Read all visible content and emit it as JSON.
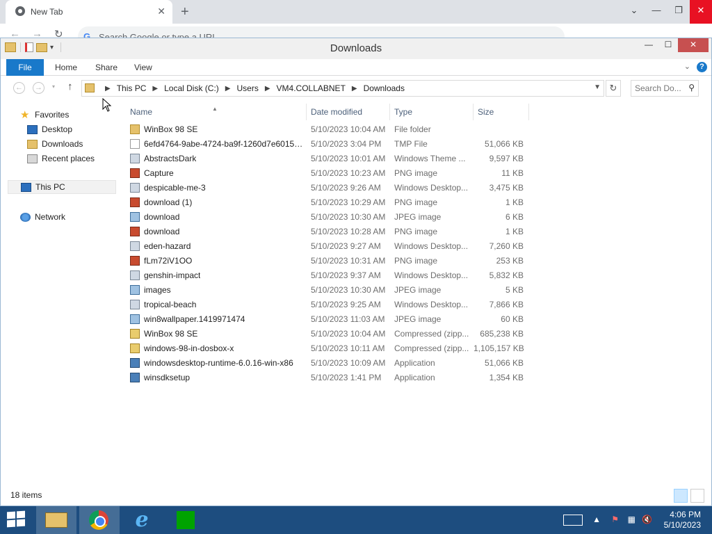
{
  "chrome": {
    "tab_title": "New Tab",
    "omnibox_placeholder": "Search Google or type a URL"
  },
  "window": {
    "title": "Downloads"
  },
  "ribbon": {
    "tabs": [
      "File",
      "Home",
      "Share",
      "View"
    ]
  },
  "address": {
    "crumbs": [
      "This PC",
      "Local Disk (C:)",
      "Users",
      "VM4.COLLABNET",
      "Downloads"
    ],
    "search_placeholder": "Search Do..."
  },
  "navpane": {
    "favorites": "Favorites",
    "desktop": "Desktop",
    "downloads": "Downloads",
    "recent": "Recent places",
    "thispc": "This PC",
    "network": "Network"
  },
  "columns": {
    "name": "Name",
    "date": "Date modified",
    "type": "Type",
    "size": "Size"
  },
  "files": [
    {
      "name": "WinBox 98 SE",
      "date": "5/10/2023 10:04 AM",
      "type": "File folder",
      "size": "",
      "icon": "folder"
    },
    {
      "name": "6efd4764-9abe-4724-ba9f-1260d7e6015b....",
      "date": "5/10/2023 3:04 PM",
      "type": "TMP File",
      "size": "51,066 KB",
      "icon": "file"
    },
    {
      "name": "AbstractsDark",
      "date": "5/10/2023 10:01 AM",
      "type": "Windows Theme ...",
      "size": "9,597 KB",
      "icon": "theme"
    },
    {
      "name": "Capture",
      "date": "5/10/2023 10:23 AM",
      "type": "PNG image",
      "size": "11 KB",
      "icon": "png"
    },
    {
      "name": "despicable-me-3",
      "date": "5/10/2023 9:26 AM",
      "type": "Windows Desktop...",
      "size": "3,475 KB",
      "icon": "theme"
    },
    {
      "name": "download (1)",
      "date": "5/10/2023 10:29 AM",
      "type": "PNG image",
      "size": "1 KB",
      "icon": "png"
    },
    {
      "name": "download",
      "date": "5/10/2023 10:30 AM",
      "type": "JPEG image",
      "size": "6 KB",
      "icon": "jpg"
    },
    {
      "name": "download",
      "date": "5/10/2023 10:28 AM",
      "type": "PNG image",
      "size": "1 KB",
      "icon": "png"
    },
    {
      "name": "eden-hazard",
      "date": "5/10/2023 9:27 AM",
      "type": "Windows Desktop...",
      "size": "7,260 KB",
      "icon": "theme"
    },
    {
      "name": "fLm72iV1OO",
      "date": "5/10/2023 10:31 AM",
      "type": "PNG image",
      "size": "253 KB",
      "icon": "png"
    },
    {
      "name": "genshin-impact",
      "date": "5/10/2023 9:37 AM",
      "type": "Windows Desktop...",
      "size": "5,832 KB",
      "icon": "theme"
    },
    {
      "name": "images",
      "date": "5/10/2023 10:30 AM",
      "type": "JPEG image",
      "size": "5 KB",
      "icon": "jpg"
    },
    {
      "name": "tropical-beach",
      "date": "5/10/2023 9:25 AM",
      "type": "Windows Desktop...",
      "size": "7,866 KB",
      "icon": "theme"
    },
    {
      "name": "win8wallpaper.1419971474",
      "date": "5/10/2023 11:03 AM",
      "type": "JPEG image",
      "size": "60 KB",
      "icon": "jpg"
    },
    {
      "name": "WinBox 98 SE",
      "date": "5/10/2023 10:04 AM",
      "type": "Compressed (zipp...",
      "size": "685,238 KB",
      "icon": "zip"
    },
    {
      "name": "windows-98-in-dosbox-x",
      "date": "5/10/2023 10:11 AM",
      "type": "Compressed (zipp...",
      "size": "1,105,157 KB",
      "icon": "zip"
    },
    {
      "name": "windowsdesktop-runtime-6.0.16-win-x86",
      "date": "5/10/2023 10:09 AM",
      "type": "Application",
      "size": "51,066 KB",
      "icon": "app"
    },
    {
      "name": "winsdksetup",
      "date": "5/10/2023 1:41 PM",
      "type": "Application",
      "size": "1,354 KB",
      "icon": "app"
    }
  ],
  "status": {
    "count": "18 items"
  },
  "taskbar": {
    "time": "4:06 PM",
    "date": "5/10/2023"
  }
}
